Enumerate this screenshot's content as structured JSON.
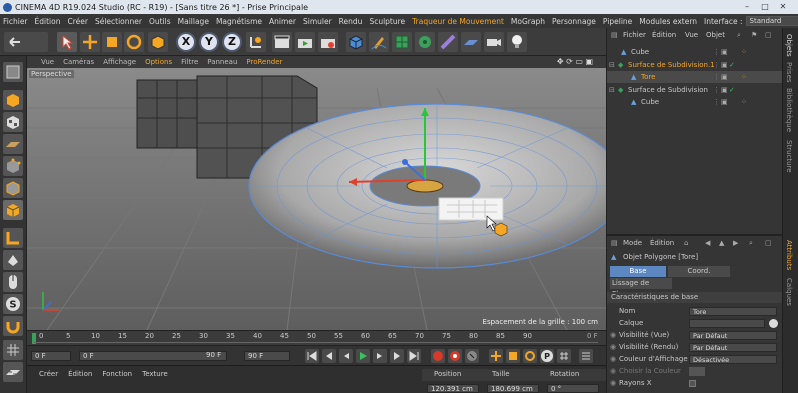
{
  "title": "CINEMA 4D R19.024 Studio (RC - R19) - [Sans titre 26 *] - Prise Principale",
  "window_buttons": [
    "–",
    "□",
    "✕"
  ],
  "menu": [
    {
      "label": "Fichier",
      "hl": false
    },
    {
      "label": "Édition",
      "hl": false
    },
    {
      "label": "Créer",
      "hl": false
    },
    {
      "label": "Sélectionner",
      "hl": false
    },
    {
      "label": "Outils",
      "hl": false
    },
    {
      "label": "Maillage",
      "hl": false
    },
    {
      "label": "Magnétisme",
      "hl": false
    },
    {
      "label": "Animer",
      "hl": false
    },
    {
      "label": "Simuler",
      "hl": false
    },
    {
      "label": "Rendu",
      "hl": false
    },
    {
      "label": "Sculpture",
      "hl": false
    },
    {
      "label": "Traqueur de Mouvement",
      "hl": true
    },
    {
      "label": "MoGraph",
      "hl": false
    },
    {
      "label": "Personnage",
      "hl": false
    },
    {
      "label": "Pipeline",
      "hl": false
    },
    {
      "label": "Modules extern",
      "hl": false
    }
  ],
  "interface_label": "Interface :",
  "interface_value": "Standard",
  "toolbar_axes": [
    "X",
    "Y",
    "Z"
  ],
  "viewport_menu": [
    {
      "label": "Vue",
      "hl": false
    },
    {
      "label": "Caméras",
      "hl": false
    },
    {
      "label": "Affichage",
      "hl": false
    },
    {
      "label": "Options",
      "hl": true
    },
    {
      "label": "Filtre",
      "hl": false
    },
    {
      "label": "Panneau",
      "hl": false
    },
    {
      "label": "ProRender",
      "hl": true
    }
  ],
  "viewport_label": "Perspective",
  "grid_spacing": "Espacement de la grille : 100 cm",
  "timeline_ticks": [
    "0",
    "5",
    "10",
    "15",
    "20",
    "25",
    "30",
    "35",
    "40",
    "45",
    "50",
    "55",
    "60",
    "65",
    "70",
    "75",
    "80",
    "85",
    "90"
  ],
  "playback": {
    "current": "0 F",
    "start": "0 F",
    "end_slider": "90 F",
    "end": "90 F"
  },
  "bottom_menu": [
    "Créer",
    "Édition",
    "Fonction",
    "Texture"
  ],
  "coords": {
    "position": "Position",
    "size": "Taille",
    "rotation": "Rotation",
    "pos_x": "120.391 cm",
    "size_x": "180.699 cm",
    "rot_h": "0 °"
  },
  "object_manager": {
    "menu": [
      "Fichier",
      "Édition",
      "Vue",
      "Objet"
    ],
    "objects": [
      {
        "name": "Cube",
        "indent": 1,
        "color": "#e0e0e0"
      },
      {
        "name": "Surface de Subdivision.1",
        "indent": 0,
        "color": "#f5a623"
      },
      {
        "name": "Tore",
        "indent": 1,
        "color": "#f5a623"
      },
      {
        "name": "Surface de Subdivision",
        "indent": 0,
        "color": "#e0e0e0"
      },
      {
        "name": "Cube",
        "indent": 1,
        "color": "#e0e0e0"
      }
    ]
  },
  "attributes": {
    "menu": [
      "Mode",
      "Édition",
      "Utilisateur"
    ],
    "object_title": "Objet Polygone [Tore]",
    "tabs": [
      "Base",
      "Coord."
    ],
    "subtab": "Lissage de Phong",
    "section": "Caractéristiques de base",
    "name_label": "Nom",
    "name_value": "Tore",
    "layer_label": "Calque",
    "rows": [
      {
        "label": "Visibilité (Vue)",
        "value": "Par Défaut"
      },
      {
        "label": "Visibilité (Rendu)",
        "value": "Par Défaut"
      },
      {
        "label": "Couleur d'Affichage",
        "value": "Désactivée"
      }
    ],
    "color_label": "Choisir la Couleur",
    "rays_label": "Rayons X"
  },
  "side_tabs": [
    "Objets",
    "Prises",
    "Bibliothèque",
    "Structure"
  ],
  "side_tabs_bottom": [
    "Attributs",
    "Calques"
  ],
  "colors": {
    "accent_orange": "#f5a623",
    "selected_tab": "#5c87c1"
  }
}
